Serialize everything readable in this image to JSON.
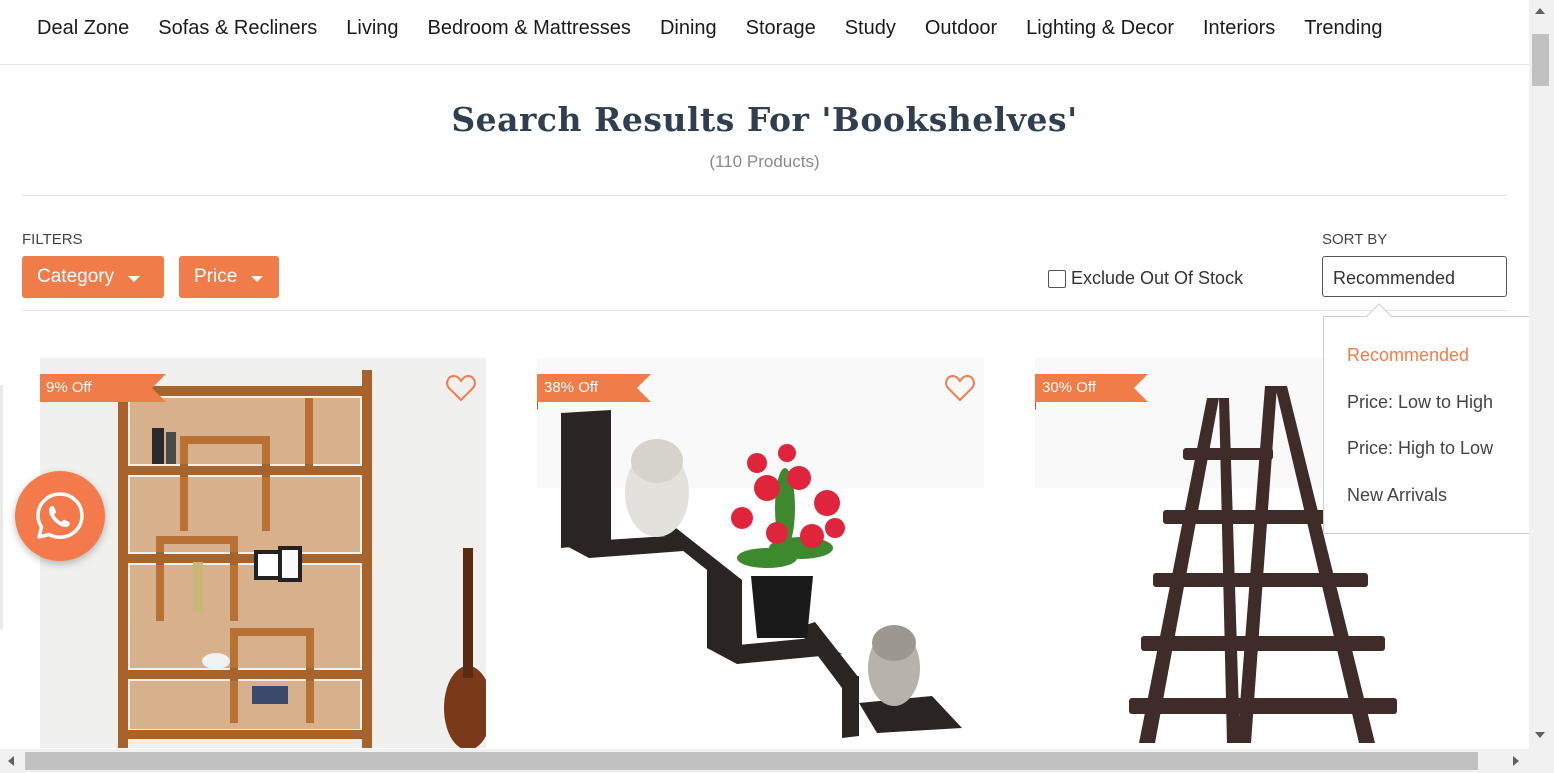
{
  "nav": {
    "items": [
      "Deal Zone",
      "Sofas & Recliners",
      "Living",
      "Bedroom & Mattresses",
      "Dining",
      "Storage",
      "Study",
      "Outdoor",
      "Lighting & Decor",
      "Interiors",
      "Trending"
    ]
  },
  "search": {
    "title": "Search Results For 'Bookshelves'",
    "count": "(110 Products)"
  },
  "filters": {
    "label": "FILTERS",
    "category_label": "Category",
    "price_label": "Price",
    "exclude_label": "Exclude Out Of Stock",
    "exclude_checked": false
  },
  "sort": {
    "label": "SORT BY",
    "selected": "Recommended",
    "options": [
      "Recommended",
      "Price: Low to High",
      "Price: High to Low",
      "New Arrivals"
    ]
  },
  "products": [
    {
      "discount": "9% Off",
      "image_icon": "wooden-bookshelf-image"
    },
    {
      "discount": "38% Off",
      "image_icon": "zigzag-wall-shelf-image"
    },
    {
      "discount": "30% Off",
      "image_icon": "a-frame-ladder-shelf-image"
    }
  ],
  "colors": {
    "accent": "#f07c4a",
    "heading": "#2f3f4f",
    "muted": "#8a8a8a"
  },
  "icons": {
    "chat": "whatsapp-icon",
    "wishlist": "heart-icon"
  }
}
